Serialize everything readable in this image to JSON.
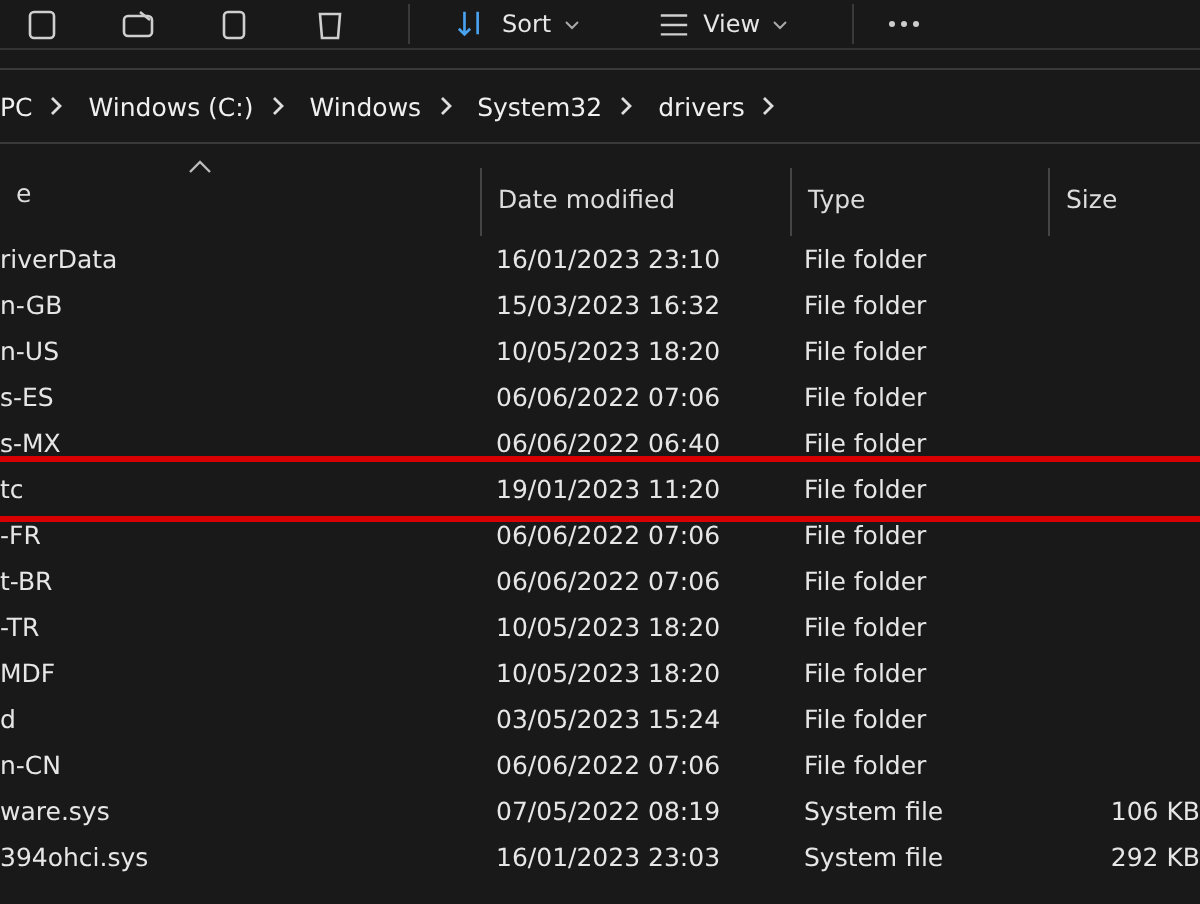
{
  "toolbar": {
    "buttons": [
      {
        "kind": "icon"
      },
      {
        "kind": "icon"
      },
      {
        "kind": "icon"
      },
      {
        "kind": "icon"
      },
      {
        "kind": "menu",
        "label": "Sort"
      },
      {
        "kind": "menu",
        "label": "View"
      },
      {
        "kind": "more"
      }
    ]
  },
  "breadcrumb": [
    "PC",
    "Windows (C:)",
    "Windows",
    "System32",
    "drivers"
  ],
  "table": {
    "columns": [
      "e",
      "Date modified",
      "Type",
      "Size"
    ],
    "rows": [
      {
        "name": "riverData",
        "date": "16/01/2023 23:10",
        "type": "File folder",
        "size": "",
        "highlighted": false
      },
      {
        "name": "n-GB",
        "date": "15/03/2023 16:32",
        "type": "File folder",
        "size": "",
        "highlighted": false
      },
      {
        "name": "n-US",
        "date": "10/05/2023 18:20",
        "type": "File folder",
        "size": "",
        "highlighted": false
      },
      {
        "name": "s-ES",
        "date": "06/06/2022 07:06",
        "type": "File folder",
        "size": "",
        "highlighted": false
      },
      {
        "name": "s-MX",
        "date": "06/06/2022 06:40",
        "type": "File folder",
        "size": "",
        "highlighted": false
      },
      {
        "name": "tc",
        "date": "19/01/2023 11:20",
        "type": "File folder",
        "size": "",
        "highlighted": true
      },
      {
        "name": "-FR",
        "date": "06/06/2022 07:06",
        "type": "File folder",
        "size": "",
        "highlighted": false
      },
      {
        "name": "t-BR",
        "date": "06/06/2022 07:06",
        "type": "File folder",
        "size": "",
        "highlighted": false
      },
      {
        "name": "-TR",
        "date": "10/05/2023 18:20",
        "type": "File folder",
        "size": "",
        "highlighted": false
      },
      {
        "name": "MDF",
        "date": "10/05/2023 18:20",
        "type": "File folder",
        "size": "",
        "highlighted": false
      },
      {
        "name": "d",
        "date": "03/05/2023 15:24",
        "type": "File folder",
        "size": "",
        "highlighted": false
      },
      {
        "name": "n-CN",
        "date": "06/06/2022 07:06",
        "type": "File folder",
        "size": "",
        "highlighted": false
      },
      {
        "name": "ware.sys",
        "date": "07/05/2022 08:19",
        "type": "System file",
        "size": "106 KB",
        "highlighted": false
      },
      {
        "name": "394ohci.sys",
        "date": "16/01/2023 23:03",
        "type": "System file",
        "size": "292 KB",
        "highlighted": false
      }
    ]
  }
}
